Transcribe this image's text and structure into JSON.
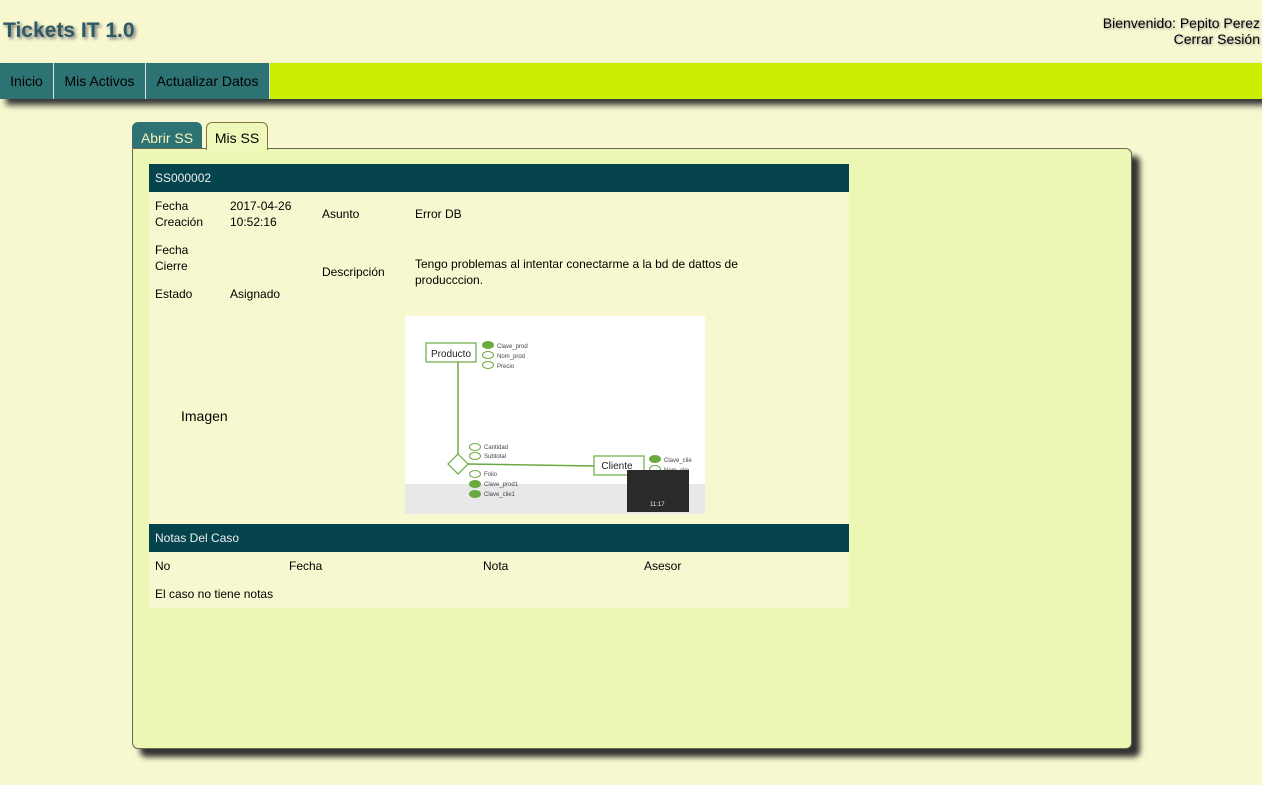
{
  "header": {
    "brand": "Tickets IT 1.0",
    "welcome": "Bienvenido: Pepito Perez",
    "logout": "Cerrar Sesión"
  },
  "nav": {
    "items": [
      "Inicio",
      "Mis Activos",
      "Actualizar Datos"
    ]
  },
  "tabs": [
    "Abrir SS",
    "Mis SS"
  ],
  "ticket": {
    "id": "SS000002",
    "fecha_creacion_label": "Fecha\nCreación",
    "fecha_creacion_value": "2017-04-26\n10:52:16",
    "asunto_label": "Asunto",
    "asunto_value": "Error DB",
    "fecha_cierre_label": "Fecha\nCierre",
    "descripcion_label": "Descripción",
    "descripcion_value": "Tengo problemas al intentar conectarme a la bd de dattos de\nproducccion.",
    "estado_label": "Estado",
    "estado_value": "Asignado",
    "imagen_label": "Imagen"
  },
  "diagram": {
    "entity1": "Producto",
    "entity1_attrs": [
      "Clave_prod",
      "Nom_prod",
      "Precio"
    ],
    "entity2": "Cliente",
    "entity2_attrs": [
      "Clave_clie",
      "Nom_clie"
    ],
    "relation_attrs": [
      "Cantidad",
      "Subtotal",
      "Folio",
      "Clave_prod1",
      "Clave_clie1"
    ],
    "video_time": "11:17"
  },
  "notes": {
    "title": "Notas Del Caso",
    "columns": [
      "No",
      "Fecha",
      "Nota",
      "Asesor"
    ],
    "empty_message": "El caso no tiene notas"
  },
  "colors": {
    "background": "#f8f8d0",
    "navbar": "#ccee00",
    "nav_item": "#2e7373",
    "header_bar": "#05444d",
    "panel": "#ecf7b6",
    "diagram_green": "#6aaa40"
  }
}
